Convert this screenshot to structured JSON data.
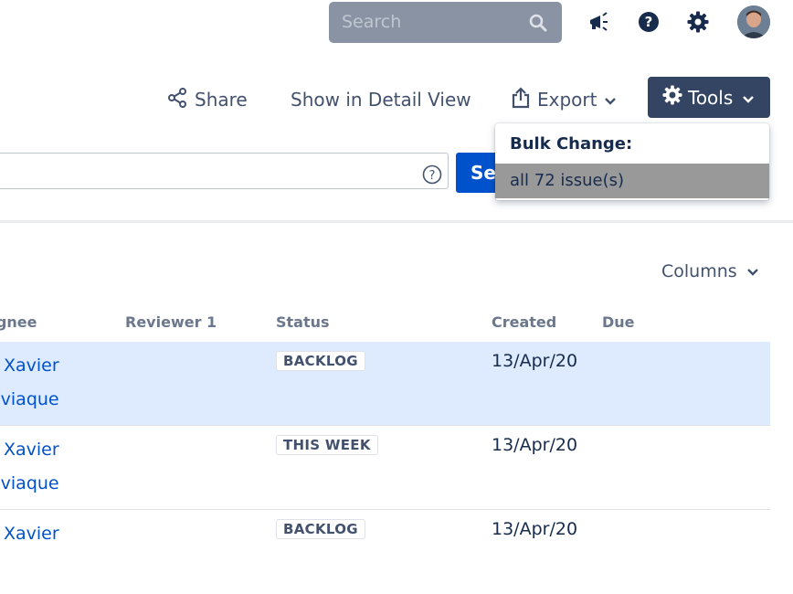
{
  "header": {
    "search_placeholder": "Search",
    "icons": [
      "search-icon",
      "megaphone-icon",
      "help-icon",
      "settings-gear-icon",
      "user-avatar"
    ]
  },
  "toolbar": {
    "share_label": "Share",
    "detail_view_label": "Show in Detail View",
    "export_label": "Export",
    "tools_label": "Tools"
  },
  "tools_menu": {
    "heading": "Bulk Change:",
    "item": "all 72 issue(s)"
  },
  "jql": {
    "value": "",
    "search_button": "Search"
  },
  "columns_label": "Columns",
  "table": {
    "headers": {
      "assignee": "Assignee",
      "reviewer": "Reviewer 1",
      "status": "Status",
      "created": "Created",
      "due": "Due"
    },
    "rows": [
      {
        "assignee_line1": "Xavier",
        "assignee_line2": "Boviaque",
        "reviewer": "",
        "status": "BACKLOG",
        "created": "13/Apr/20",
        "due": "",
        "selected": true
      },
      {
        "assignee_line1": "Xavier",
        "assignee_line2": "Boviaque",
        "reviewer": "",
        "status": "THIS WEEK",
        "created": "13/Apr/20",
        "due": "",
        "selected": false
      },
      {
        "assignee_line1": "Xavier",
        "assignee_line2": "",
        "reviewer": "",
        "status": "BACKLOG",
        "created": "13/Apr/20",
        "due": "",
        "selected": false
      }
    ]
  },
  "colors": {
    "search_bg": "#8993a4",
    "tools_bg": "#344563",
    "primary": "#0052cc",
    "selected_row": "#deebff",
    "menu_hover": "#999999"
  }
}
